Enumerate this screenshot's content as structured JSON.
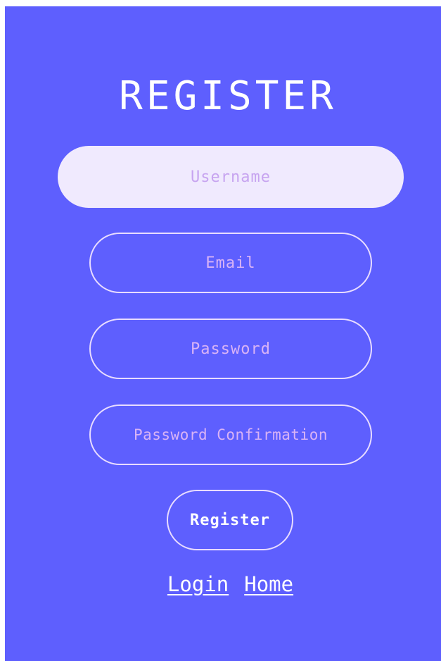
{
  "form": {
    "title": "REGISTER",
    "username_placeholder": "Username",
    "email_placeholder": "Email",
    "password_placeholder": "Password",
    "password_confirmation_placeholder": "Password Confirmation",
    "submit_label": "Register"
  },
  "links": {
    "login_label": "Login",
    "home_label": "Home"
  },
  "colors": {
    "panel_background": "#5e5ffe",
    "focused_field_background": "#f0eafe",
    "placeholder_text": "#d9b3f6",
    "border": "#e8dcff",
    "text": "#ffffff"
  }
}
